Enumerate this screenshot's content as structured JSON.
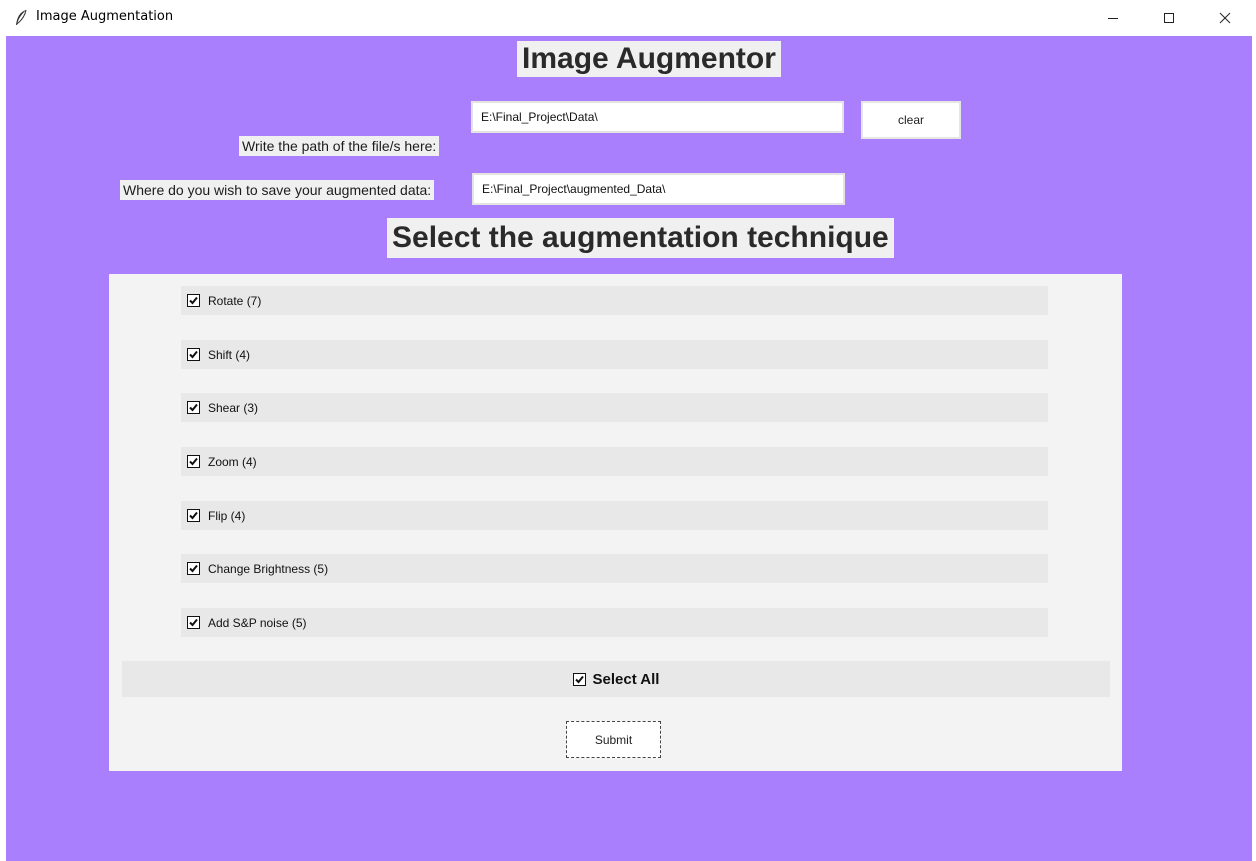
{
  "window": {
    "title": "Image Augmentation",
    "icon": "feather-icon",
    "controls": [
      "minimize-icon",
      "maximize-icon",
      "close-icon"
    ]
  },
  "colors": {
    "background": "#a97ffe",
    "panel": "#f3f3f4",
    "row": "#e8e8e8",
    "label_bg": "#f0f0f0"
  },
  "header": {
    "title": "Image Augmentor"
  },
  "path_field": {
    "label": "Write the path of the file/s here:",
    "value": "E:\\Final_Project\\Data\\"
  },
  "clear_button": {
    "label": "clear"
  },
  "save_field": {
    "label": "Where do you wish to save your augmented data:",
    "value": "E:\\Final_Project\\augmented_Data\\"
  },
  "technique": {
    "heading": "Select the augmentation technique",
    "options": [
      {
        "label": "Rotate (7)",
        "checked": true
      },
      {
        "label": "Shift (4)",
        "checked": true
      },
      {
        "label": "Shear (3)",
        "checked": true
      },
      {
        "label": "Zoom (4)",
        "checked": true
      },
      {
        "label": "Flip (4)",
        "checked": true
      },
      {
        "label": "Change Brightness (5)",
        "checked": true
      },
      {
        "label": "Add S&P noise (5)",
        "checked": true
      }
    ],
    "select_all": {
      "label": "Select All",
      "checked": true
    }
  },
  "submit_button": {
    "label": "Submit"
  }
}
